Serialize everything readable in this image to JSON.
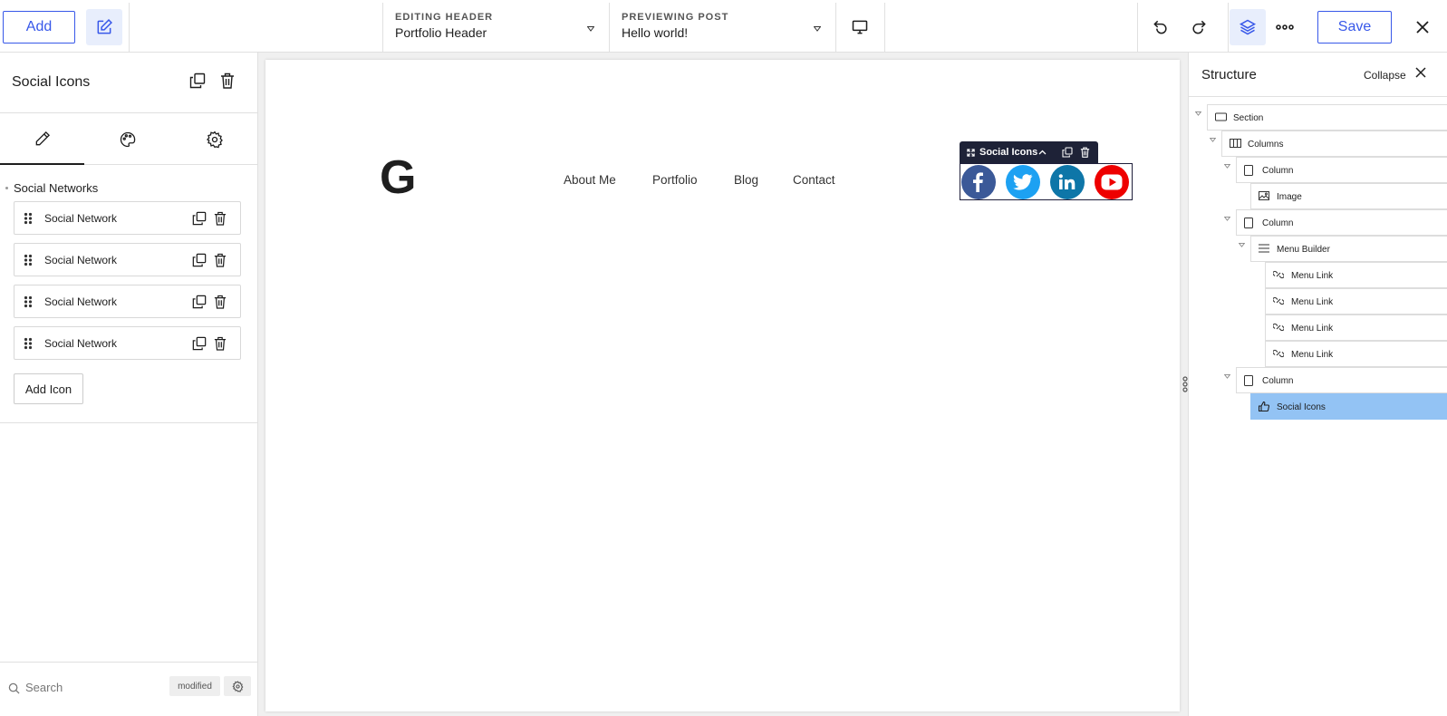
{
  "topbar": {
    "add_label": "Add",
    "editing_label": "EDITING HEADER",
    "editing_value": "Portfolio Header",
    "previewing_label": "PREVIEWING POST",
    "previewing_value": "Hello world!",
    "save_label": "Save"
  },
  "left_panel": {
    "element_title": "Social Icons",
    "section_label": "Social Networks",
    "items": [
      {
        "label": "Social Network"
      },
      {
        "label": "Social Network"
      },
      {
        "label": "Social Network"
      },
      {
        "label": "Social Network"
      }
    ],
    "add_icon_label": "Add Icon",
    "search_placeholder": "Search",
    "modified_badge": "modified"
  },
  "canvas": {
    "logo_letter": "G",
    "nav_links": [
      "About Me",
      "Portfolio",
      "Blog",
      "Contact"
    ],
    "selected_label": "Social Icons",
    "social_icons": [
      {
        "name": "facebook-icon",
        "color": "#3b5998"
      },
      {
        "name": "twitter-icon",
        "color": "#1da1f2"
      },
      {
        "name": "linkedin-icon",
        "color": "#0e76a8"
      },
      {
        "name": "youtube-icon",
        "color": "#e00"
      }
    ]
  },
  "structure": {
    "title": "Structure",
    "collapse_label": "Collapse",
    "nodes": [
      {
        "label": "Section",
        "icon": "section-icon"
      },
      {
        "label": "Columns",
        "icon": "columns-icon"
      },
      {
        "label": "Column",
        "icon": "column-icon"
      },
      {
        "label": "Image",
        "icon": "image-icon"
      },
      {
        "label": "Column",
        "icon": "column-icon"
      },
      {
        "label": "Menu Builder",
        "icon": "menu-icon"
      },
      {
        "label": "Menu Link",
        "icon": "link-icon"
      },
      {
        "label": "Menu Link",
        "icon": "link-icon"
      },
      {
        "label": "Menu Link",
        "icon": "link-icon"
      },
      {
        "label": "Menu Link",
        "icon": "link-icon"
      },
      {
        "label": "Column",
        "icon": "column-icon"
      },
      {
        "label": "Social Icons",
        "icon": "thumbs-up-icon",
        "selected": true
      }
    ]
  },
  "colors": {
    "accent": "#3858e9",
    "selection": "#93c3f4",
    "toolbar_dark": "#1e2237"
  }
}
